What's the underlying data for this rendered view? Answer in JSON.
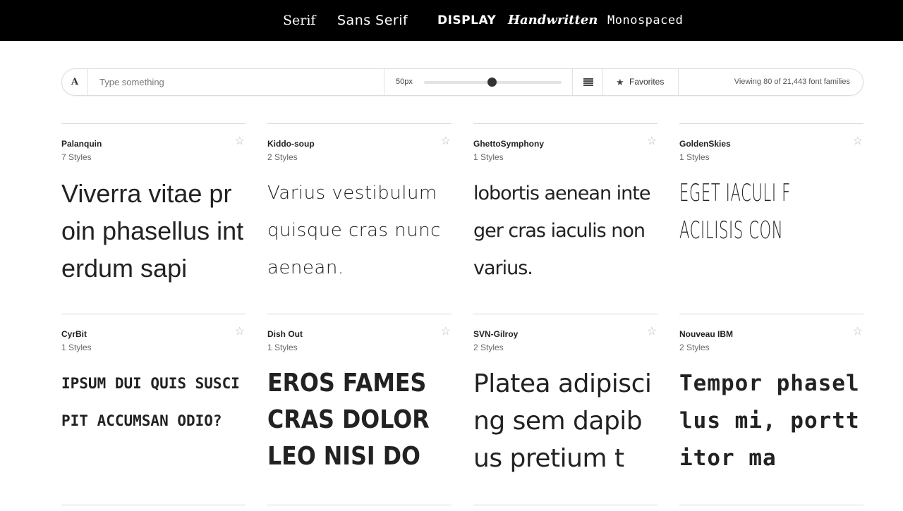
{
  "categories": {
    "serif": "Serif",
    "sans_serif": "Sans Serif",
    "display": "DISPLAY",
    "handwritten": "Handwritten",
    "monospaced": "Monospaced"
  },
  "toolbar": {
    "font_icon": "A",
    "search_placeholder": "Type something",
    "size_label": "50px",
    "size_value": 50,
    "favorites_label": "Favorites",
    "viewing_text": "Viewing 80 of 21,443 font families"
  },
  "fonts": [
    {
      "name": "Palanquin",
      "styles": "7 Styles",
      "sample": "Viverra vitae proin phasellus interdum sapi"
    },
    {
      "name": "Kiddo-soup",
      "styles": "2 Styles",
      "sample": "Varius vestibulum quisque cras nunc aenean."
    },
    {
      "name": "GhettoSymphony",
      "styles": "1 Styles",
      "sample": "lobortis aenean integer cras iaculis non varius."
    },
    {
      "name": "GoldenSkies",
      "styles": "1 Styles",
      "sample": "Eget iaculi facilisis congue."
    },
    {
      "name": "CyrBit",
      "styles": "1 Styles",
      "sample": "Ipsum dui quis suscipit accumsan odio?"
    },
    {
      "name": "Dish Out",
      "styles": "1 Styles",
      "sample": "Eros fames cras dolor leo nisi don"
    },
    {
      "name": "SVN-Gilroy",
      "styles": "2 Styles",
      "sample": "Platea adipiscing sem dapibus pretium t"
    },
    {
      "name": "Nouveau IBM",
      "styles": "2 Styles",
      "sample": "Tempor phasellus mi, porttitor ma"
    }
  ],
  "colors": {
    "nav_background": "#000000",
    "nav_text": "#ffffff",
    "star_inactive": "#bbbbbb",
    "slider_thumb": "#333333"
  },
  "icons": {
    "favorite": "star-outline",
    "favorites_filter": "star-filled",
    "list_view": "list-icon"
  }
}
